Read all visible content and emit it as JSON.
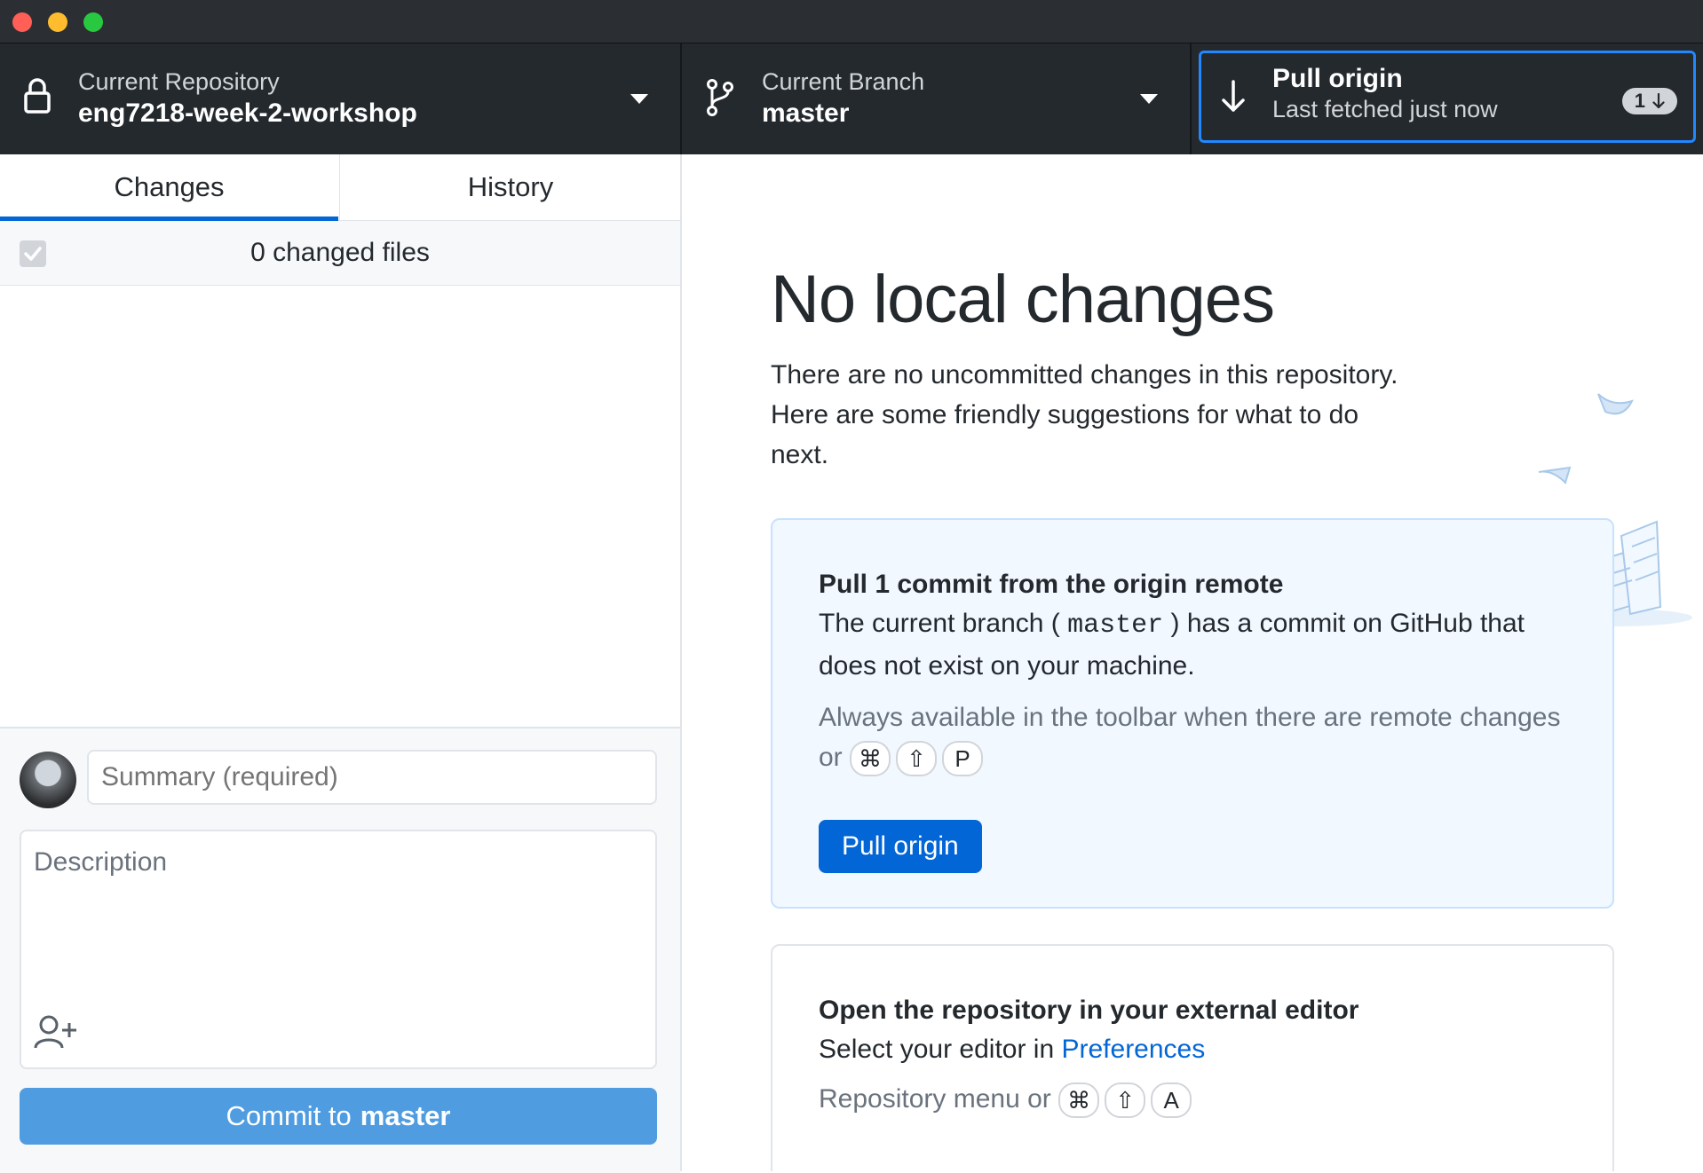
{
  "toolbar": {
    "repository": {
      "label": "Current Repository",
      "value": "eng7218-week-2-workshop"
    },
    "branch": {
      "label": "Current Branch",
      "value": "master"
    },
    "pull": {
      "title": "Pull origin",
      "subtitle": "Last fetched just now",
      "badge_count": "1"
    }
  },
  "sidebar": {
    "tabs": [
      {
        "label": "Changes",
        "active": true
      },
      {
        "label": "History",
        "active": false
      }
    ],
    "changed_files": "0 changed files",
    "commit": {
      "summary_placeholder": "Summary (required)",
      "description_placeholder": "Description",
      "button_prefix": "Commit to",
      "button_branch": "master"
    }
  },
  "main": {
    "heading": "No local changes",
    "intro": "There are no uncommitted changes in this repository. Here are some friendly suggestions for what to do next.",
    "pull_card": {
      "title": "Pull 1 commit from the origin remote",
      "desc_before": "The current branch (",
      "branch": "master",
      "desc_after": ") has a commit on GitHub that does not exist on your machine.",
      "hint": "Always available in the toolbar when there are remote changes or",
      "keys": [
        "⌘",
        "⇧",
        "P"
      ],
      "button": "Pull origin"
    },
    "editor_card": {
      "title": "Open the repository in your external editor",
      "desc": "Select your editor in",
      "link": "Preferences",
      "hint": "Repository menu or",
      "keys": [
        "⌘",
        "⇧",
        "A"
      ]
    }
  },
  "colors": {
    "accent": "#0366d6",
    "toolbar_bg": "#24292e",
    "commit_button": "#4f9ce0",
    "card_bg": "#f1f8ff"
  }
}
